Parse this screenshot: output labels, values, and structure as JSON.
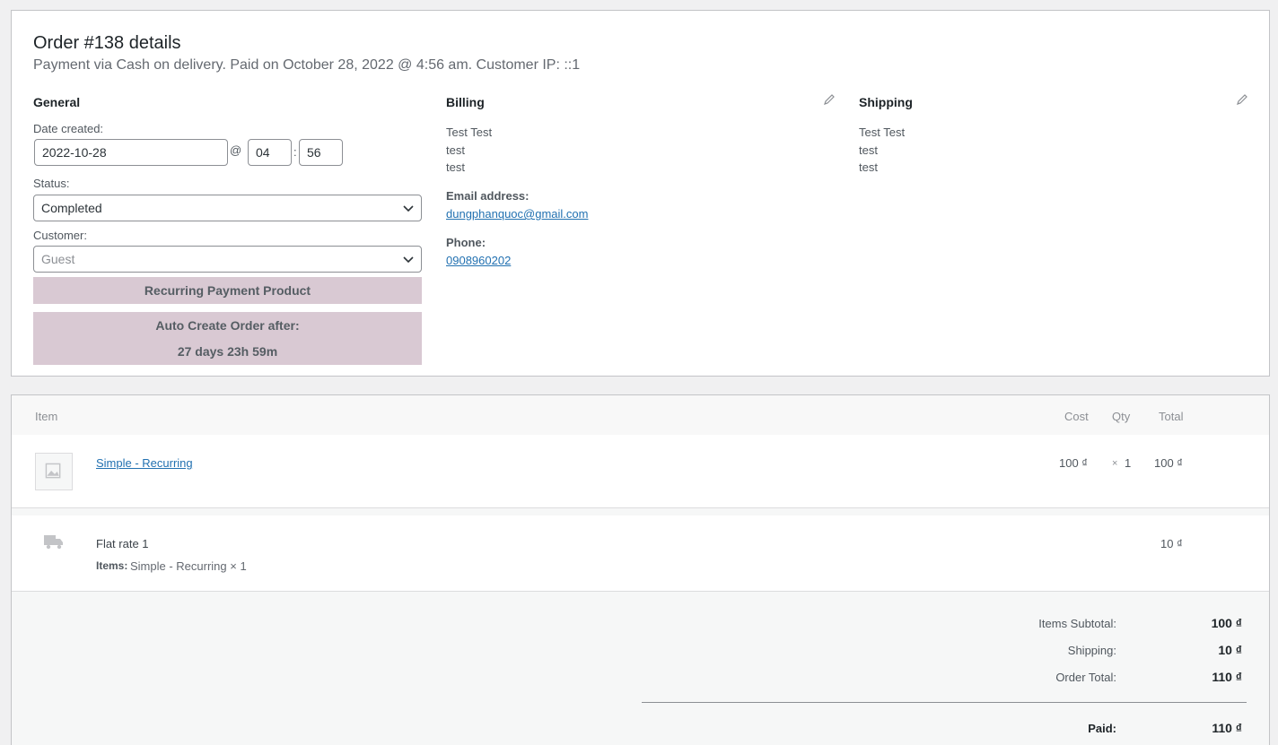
{
  "order": {
    "title": "Order #138 details",
    "subtitle": "Payment via Cash on delivery. Paid on October 28, 2022 @ 4:56 am. Customer IP: ::1"
  },
  "general": {
    "heading": "General",
    "date_label": "Date created:",
    "date_value": "2022-10-28",
    "at_sep": "@",
    "time_sep": ":",
    "hour": "04",
    "minute": "56",
    "status_label": "Status:",
    "status_value": "Completed",
    "customer_label": "Customer:",
    "customer_value": "Guest",
    "recurring_label": "Recurring Payment Product",
    "auto_create_label": "Auto Create Order after:",
    "auto_create_value": "27 days 23h 59m"
  },
  "billing": {
    "heading": "Billing",
    "name": "Test Test",
    "line1": "test",
    "line2": "test",
    "email_label": "Email address:",
    "email": "dungphanquoc@gmail.com",
    "phone_label": "Phone:",
    "phone": "0908960202"
  },
  "shipping": {
    "heading": "Shipping",
    "name": "Test Test",
    "line1": "test",
    "line2": "test"
  },
  "items_table": {
    "headers": {
      "item": "Item",
      "cost": "Cost",
      "qty": "Qty",
      "total": "Total"
    },
    "rows": [
      {
        "name": "Simple - Recurring",
        "cost": "100 ₫",
        "qty_sign": "×",
        "qty": "1",
        "total": "100 ₫"
      }
    ],
    "shipping_row": {
      "name": "Flat rate 1",
      "items_label": "Items:",
      "items_value": "Simple - Recurring × 1",
      "total": "10 ₫"
    }
  },
  "totals": {
    "subtotal_label": "Items Subtotal:",
    "subtotal_value": "100 ₫",
    "shipping_label": "Shipping:",
    "shipping_value": "10 ₫",
    "order_total_label": "Order Total:",
    "order_total_value": "110 ₫",
    "paid_label": "Paid:",
    "paid_value": "110 ₫"
  }
}
